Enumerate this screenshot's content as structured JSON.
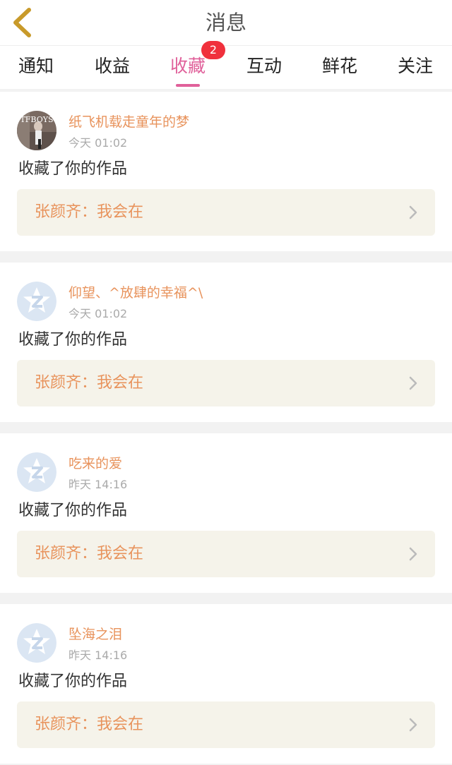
{
  "header": {
    "title": "消息",
    "back_icon": "chevron-left-icon"
  },
  "tabs": [
    {
      "label": "通知",
      "active": false
    },
    {
      "label": "收益",
      "active": false
    },
    {
      "label": "收藏",
      "active": true,
      "badge": "2"
    },
    {
      "label": "互动",
      "active": false
    },
    {
      "label": "鲜花",
      "active": false
    },
    {
      "label": "关注",
      "active": false
    }
  ],
  "accent_color": "#e0609a",
  "name_color": "#e8935c",
  "badge_color": "#f0303c",
  "messages": [
    {
      "username": "纸飞机载走童年的梦",
      "time": "今天 01:02",
      "action": "收藏了你的作品",
      "work_title": "张颜齐：我会在",
      "avatar": "photo-avatar",
      "avatar_text": "TFBOYS"
    },
    {
      "username": "仰望、^放肆的幸福^\\",
      "time": "今天 01:02",
      "action": "收藏了你的作品",
      "work_title": "张颜齐：我会在",
      "avatar": "default-avatar-icon"
    },
    {
      "username": "吃来的爱",
      "time": "昨天 14:16",
      "action": "收藏了你的作品",
      "work_title": "张颜齐：我会在",
      "avatar": "default-avatar-icon"
    },
    {
      "username": "坠海之泪",
      "time": "昨天 14:16",
      "action": "收藏了你的作品",
      "work_title": "张颜齐：我会在",
      "avatar": "default-avatar-icon"
    }
  ]
}
